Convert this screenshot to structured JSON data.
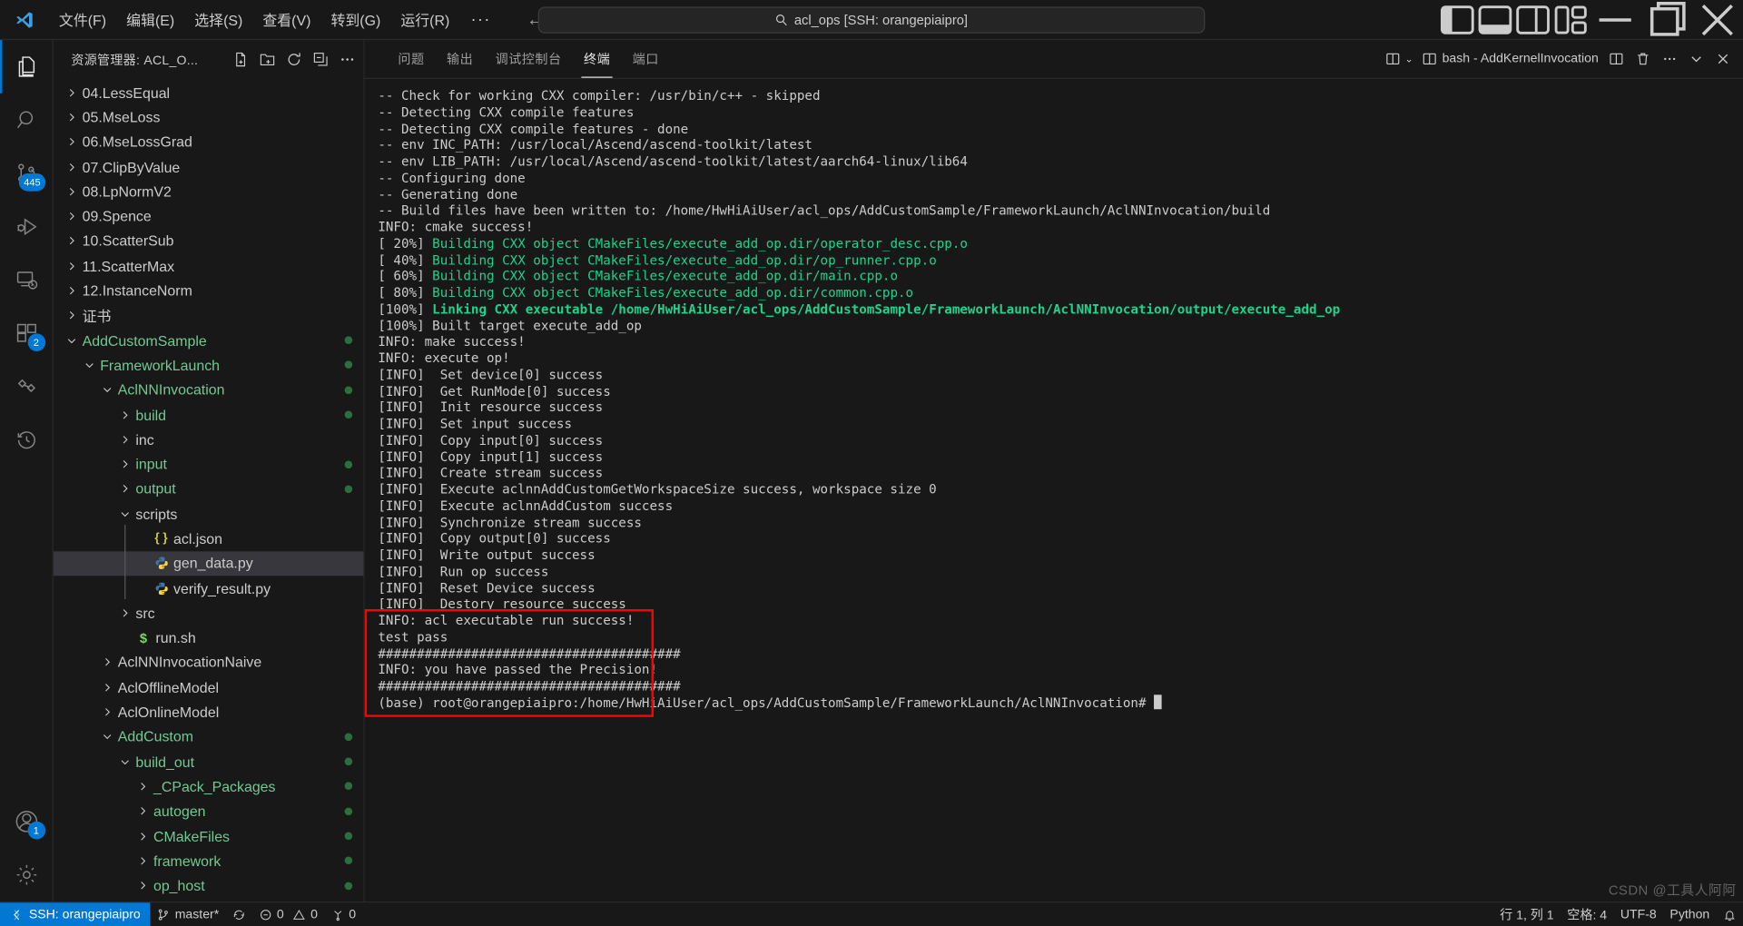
{
  "titlebar": {
    "logo": "vscode-logo",
    "menu": [
      "文件(F)",
      "编辑(E)",
      "选择(S)",
      "查看(V)",
      "转到(G)",
      "运行(R)"
    ],
    "menu_more": "···",
    "nav_back": "←",
    "nav_forward": "→",
    "command_center": "acl_ops [SSH: orangepiaipro]",
    "layout_icons": [
      "toggle-primary-sidebar-icon",
      "toggle-panel-icon",
      "toggle-secondary-sidebar-icon",
      "customize-layout-icon"
    ],
    "window_minimize": "–",
    "window_maximize": "❐",
    "window_close": "✕"
  },
  "activitybar": {
    "items": [
      {
        "name": "explorer",
        "badge": ""
      },
      {
        "name": "search",
        "badge": ""
      },
      {
        "name": "source-control",
        "badge": "445"
      },
      {
        "name": "run-and-debug",
        "badge": ""
      },
      {
        "name": "remote-explorer",
        "badge": ""
      },
      {
        "name": "extensions",
        "badge": "2"
      },
      {
        "name": "testing",
        "badge": ""
      },
      {
        "name": "timeline",
        "badge": ""
      }
    ],
    "bottom": [
      {
        "name": "accounts",
        "badge": "1"
      },
      {
        "name": "settings",
        "badge": ""
      }
    ]
  },
  "sidebar": {
    "title": "资源管理器: ACL_O...",
    "header_icons": [
      "new-file-icon",
      "new-folder-icon",
      "refresh-icon",
      "collapse-all-icon",
      "more-actions-icon"
    ],
    "tree": [
      {
        "label": "04.LessEqual",
        "indent": 0,
        "chevron": "right",
        "color": "#cccccc",
        "icon": "",
        "dot": false
      },
      {
        "label": "05.MseLoss",
        "indent": 0,
        "chevron": "right",
        "color": "#cccccc",
        "icon": "",
        "dot": false
      },
      {
        "label": "06.MseLossGrad",
        "indent": 0,
        "chevron": "right",
        "color": "#cccccc",
        "icon": "",
        "dot": false
      },
      {
        "label": "07.ClipByValue",
        "indent": 0,
        "chevron": "right",
        "color": "#cccccc",
        "icon": "",
        "dot": false
      },
      {
        "label": "08.LpNormV2",
        "indent": 0,
        "chevron": "right",
        "color": "#cccccc",
        "icon": "",
        "dot": false
      },
      {
        "label": "09.Spence",
        "indent": 0,
        "chevron": "right",
        "color": "#cccccc",
        "icon": "",
        "dot": false
      },
      {
        "label": "10.ScatterSub",
        "indent": 0,
        "chevron": "right",
        "color": "#cccccc",
        "icon": "",
        "dot": false
      },
      {
        "label": "11.ScatterMax",
        "indent": 0,
        "chevron": "right",
        "color": "#cccccc",
        "icon": "",
        "dot": false
      },
      {
        "label": "12.InstanceNorm",
        "indent": 0,
        "chevron": "right",
        "color": "#cccccc",
        "icon": "",
        "dot": false
      },
      {
        "label": "证书",
        "indent": 0,
        "chevron": "right",
        "color": "#cccccc",
        "icon": "",
        "dot": false
      },
      {
        "label": "AddCustomSample",
        "indent": 0,
        "chevron": "down",
        "color": "#73c991",
        "icon": "",
        "dot": true
      },
      {
        "label": "FrameworkLaunch",
        "indent": 1,
        "chevron": "down",
        "color": "#73c991",
        "icon": "",
        "dot": true
      },
      {
        "label": "AclNNInvocation",
        "indent": 2,
        "chevron": "down",
        "color": "#73c991",
        "icon": "",
        "dot": true
      },
      {
        "label": "build",
        "indent": 3,
        "chevron": "right",
        "color": "#73c991",
        "icon": "",
        "dot": true
      },
      {
        "label": "inc",
        "indent": 3,
        "chevron": "right",
        "color": "#cccccc",
        "icon": "",
        "dot": false
      },
      {
        "label": "input",
        "indent": 3,
        "chevron": "right",
        "color": "#73c991",
        "icon": "",
        "dot": true
      },
      {
        "label": "output",
        "indent": 3,
        "chevron": "right",
        "color": "#73c991",
        "icon": "",
        "dot": true
      },
      {
        "label": "scripts",
        "indent": 3,
        "chevron": "down",
        "color": "#cccccc",
        "icon": "",
        "dot": false
      },
      {
        "label": "acl.json",
        "indent": 4,
        "chevron": "none",
        "color": "#cccccc",
        "icon": "json-file-icon",
        "dot": false
      },
      {
        "label": "gen_data.py",
        "indent": 4,
        "chevron": "none",
        "color": "#cccccc",
        "icon": "python-file-icon",
        "dot": false,
        "selected": true
      },
      {
        "label": "verify_result.py",
        "indent": 4,
        "chevron": "none",
        "color": "#cccccc",
        "icon": "python-file-icon",
        "dot": false
      },
      {
        "label": "src",
        "indent": 3,
        "chevron": "right",
        "color": "#cccccc",
        "icon": "",
        "dot": false
      },
      {
        "label": "run.sh",
        "indent": 3,
        "chevron": "none",
        "color": "#cccccc",
        "icon": "shell-file-icon",
        "dot": false
      },
      {
        "label": "AclNNInvocationNaive",
        "indent": 2,
        "chevron": "right",
        "color": "#cccccc",
        "icon": "",
        "dot": false
      },
      {
        "label": "AclOfflineModel",
        "indent": 2,
        "chevron": "right",
        "color": "#cccccc",
        "icon": "",
        "dot": false
      },
      {
        "label": "AclOnlineModel",
        "indent": 2,
        "chevron": "right",
        "color": "#cccccc",
        "icon": "",
        "dot": false
      },
      {
        "label": "AddCustom",
        "indent": 2,
        "chevron": "down",
        "color": "#73c991",
        "icon": "",
        "dot": true
      },
      {
        "label": "build_out",
        "indent": 3,
        "chevron": "down",
        "color": "#73c991",
        "icon": "",
        "dot": true
      },
      {
        "label": "_CPack_Packages",
        "indent": 4,
        "chevron": "right",
        "color": "#73c991",
        "icon": "",
        "dot": true
      },
      {
        "label": "autogen",
        "indent": 4,
        "chevron": "right",
        "color": "#73c991",
        "icon": "",
        "dot": true
      },
      {
        "label": "CMakeFiles",
        "indent": 4,
        "chevron": "right",
        "color": "#73c991",
        "icon": "",
        "dot": true
      },
      {
        "label": "framework",
        "indent": 4,
        "chevron": "right",
        "color": "#73c991",
        "icon": "",
        "dot": true
      },
      {
        "label": "op_host",
        "indent": 4,
        "chevron": "right",
        "color": "#73c991",
        "icon": "",
        "dot": true
      }
    ]
  },
  "panel": {
    "tabs": [
      {
        "label": "问题",
        "active": false
      },
      {
        "label": "输出",
        "active": false
      },
      {
        "label": "调试控制台",
        "active": false
      },
      {
        "label": "终端",
        "active": true
      },
      {
        "label": "端口",
        "active": false
      }
    ],
    "actions": {
      "split_selector": "split-terminal-dropdown-icon",
      "terminal_name": "bash - AddKernelInvocation",
      "split_icon": "split-terminal-icon",
      "kill_icon": "kill-terminal-icon",
      "more_icon": "more-actions-icon",
      "hide_icon": "hide-panel-icon",
      "close_icon": "close-panel-icon"
    }
  },
  "terminal": {
    "lines": [
      {
        "segments": [
          {
            "t": "-- Check for working CXX compiler: /usr/bin/c++ - skipped",
            "c": "w"
          }
        ]
      },
      {
        "segments": [
          {
            "t": "-- Detecting CXX compile features",
            "c": "w"
          }
        ]
      },
      {
        "segments": [
          {
            "t": "-- Detecting CXX compile features - done",
            "c": "w"
          }
        ]
      },
      {
        "segments": [
          {
            "t": "-- env INC_PATH: /usr/local/Ascend/ascend-toolkit/latest",
            "c": "w"
          }
        ]
      },
      {
        "segments": [
          {
            "t": "-- env LIB_PATH: /usr/local/Ascend/ascend-toolkit/latest/aarch64-linux/lib64",
            "c": "w"
          }
        ]
      },
      {
        "segments": [
          {
            "t": "-- Configuring done",
            "c": "w"
          }
        ]
      },
      {
        "segments": [
          {
            "t": "-- Generating done",
            "c": "w"
          }
        ]
      },
      {
        "segments": [
          {
            "t": "-- Build files have been written to: /home/HwHiAiUser/acl_ops/AddCustomSample/FrameworkLaunch/AclNNInvocation/build",
            "c": "w"
          }
        ]
      },
      {
        "segments": [
          {
            "t": "INFO: cmake success!",
            "c": "w"
          }
        ]
      },
      {
        "segments": [
          {
            "t": "[ 20%] ",
            "c": "w"
          },
          {
            "t": "Building CXX object CMakeFiles/execute_add_op.dir/operator_desc.cpp.o",
            "c": "g"
          }
        ]
      },
      {
        "segments": [
          {
            "t": "[ 40%] ",
            "c": "w"
          },
          {
            "t": "Building CXX object CMakeFiles/execute_add_op.dir/op_runner.cpp.o",
            "c": "g"
          }
        ]
      },
      {
        "segments": [
          {
            "t": "[ 60%] ",
            "c": "w"
          },
          {
            "t": "Building CXX object CMakeFiles/execute_add_op.dir/main.cpp.o",
            "c": "g"
          }
        ]
      },
      {
        "segments": [
          {
            "t": "[ 80%] ",
            "c": "w"
          },
          {
            "t": "Building CXX object CMakeFiles/execute_add_op.dir/common.cpp.o",
            "c": "g"
          }
        ]
      },
      {
        "segments": [
          {
            "t": "[100%] ",
            "c": "w"
          },
          {
            "t": "Linking CXX executable /home/HwHiAiUser/acl_ops/AddCustomSample/FrameworkLaunch/AclNNInvocation/output/execute_add_op",
            "c": "gb"
          }
        ]
      },
      {
        "segments": [
          {
            "t": "[100%] Built target execute_add_op",
            "c": "w"
          }
        ]
      },
      {
        "segments": [
          {
            "t": "INFO: make success!",
            "c": "w"
          }
        ]
      },
      {
        "segments": [
          {
            "t": "INFO: execute op!",
            "c": "w"
          }
        ]
      },
      {
        "segments": [
          {
            "t": "[INFO]  Set device[0] success",
            "c": "w"
          }
        ]
      },
      {
        "segments": [
          {
            "t": "[INFO]  Get RunMode[0] success",
            "c": "w"
          }
        ]
      },
      {
        "segments": [
          {
            "t": "[INFO]  Init resource success",
            "c": "w"
          }
        ]
      },
      {
        "segments": [
          {
            "t": "[INFO]  Set input success",
            "c": "w"
          }
        ]
      },
      {
        "segments": [
          {
            "t": "[INFO]  Copy input[0] success",
            "c": "w"
          }
        ]
      },
      {
        "segments": [
          {
            "t": "[INFO]  Copy input[1] success",
            "c": "w"
          }
        ]
      },
      {
        "segments": [
          {
            "t": "[INFO]  Create stream success",
            "c": "w"
          }
        ]
      },
      {
        "segments": [
          {
            "t": "[INFO]  Execute aclnnAddCustomGetWorkspaceSize success, workspace size 0",
            "c": "w"
          }
        ]
      },
      {
        "segments": [
          {
            "t": "[INFO]  Execute aclnnAddCustom success",
            "c": "w"
          }
        ]
      },
      {
        "segments": [
          {
            "t": "[INFO]  Synchronize stream success",
            "c": "w"
          }
        ]
      },
      {
        "segments": [
          {
            "t": "[INFO]  Copy output[0] success",
            "c": "w"
          }
        ]
      },
      {
        "segments": [
          {
            "t": "[INFO]  Write output success",
            "c": "w"
          }
        ]
      },
      {
        "segments": [
          {
            "t": "[INFO]  Run op success",
            "c": "w"
          }
        ]
      },
      {
        "segments": [
          {
            "t": "[INFO]  Reset Device success",
            "c": "w"
          }
        ]
      },
      {
        "segments": [
          {
            "t": "[INFO]  Destory resource success",
            "c": "w"
          }
        ]
      },
      {
        "segments": [
          {
            "t": "INFO: acl executable run success!",
            "c": "w"
          }
        ]
      },
      {
        "segments": [
          {
            "t": "test pass",
            "c": "w"
          }
        ]
      },
      {
        "segments": [
          {
            "t": "",
            "c": "w"
          }
        ]
      },
      {
        "segments": [
          {
            "t": "#######################################",
            "c": "w"
          }
        ]
      },
      {
        "segments": [
          {
            "t": "INFO: you have passed the Precision!",
            "c": "w"
          }
        ]
      },
      {
        "segments": [
          {
            "t": "#######################################",
            "c": "w"
          }
        ]
      },
      {
        "segments": [
          {
            "t": "",
            "c": "w"
          }
        ]
      },
      {
        "segments": [
          {
            "t": "(base) root@orangepiaipro:/home/HwHiAiUser/acl_ops/AddCustomSample/FrameworkLaunch/AclNNInvocation# ",
            "c": "w"
          }
        ]
      }
    ],
    "highlight_color": "#ff0000"
  },
  "statusbar": {
    "remote": "SSH: orangepiaipro",
    "branch": "master*",
    "sync": "sync-icon",
    "errors": "0",
    "warnings": "0",
    "ports": "0",
    "position": "行 1, 列 1",
    "spaces": "空格: 4",
    "encoding": "UTF-8",
    "language": "Python",
    "bell": "notifications-icon"
  },
  "watermark": "CSDN @工具人阿阿"
}
